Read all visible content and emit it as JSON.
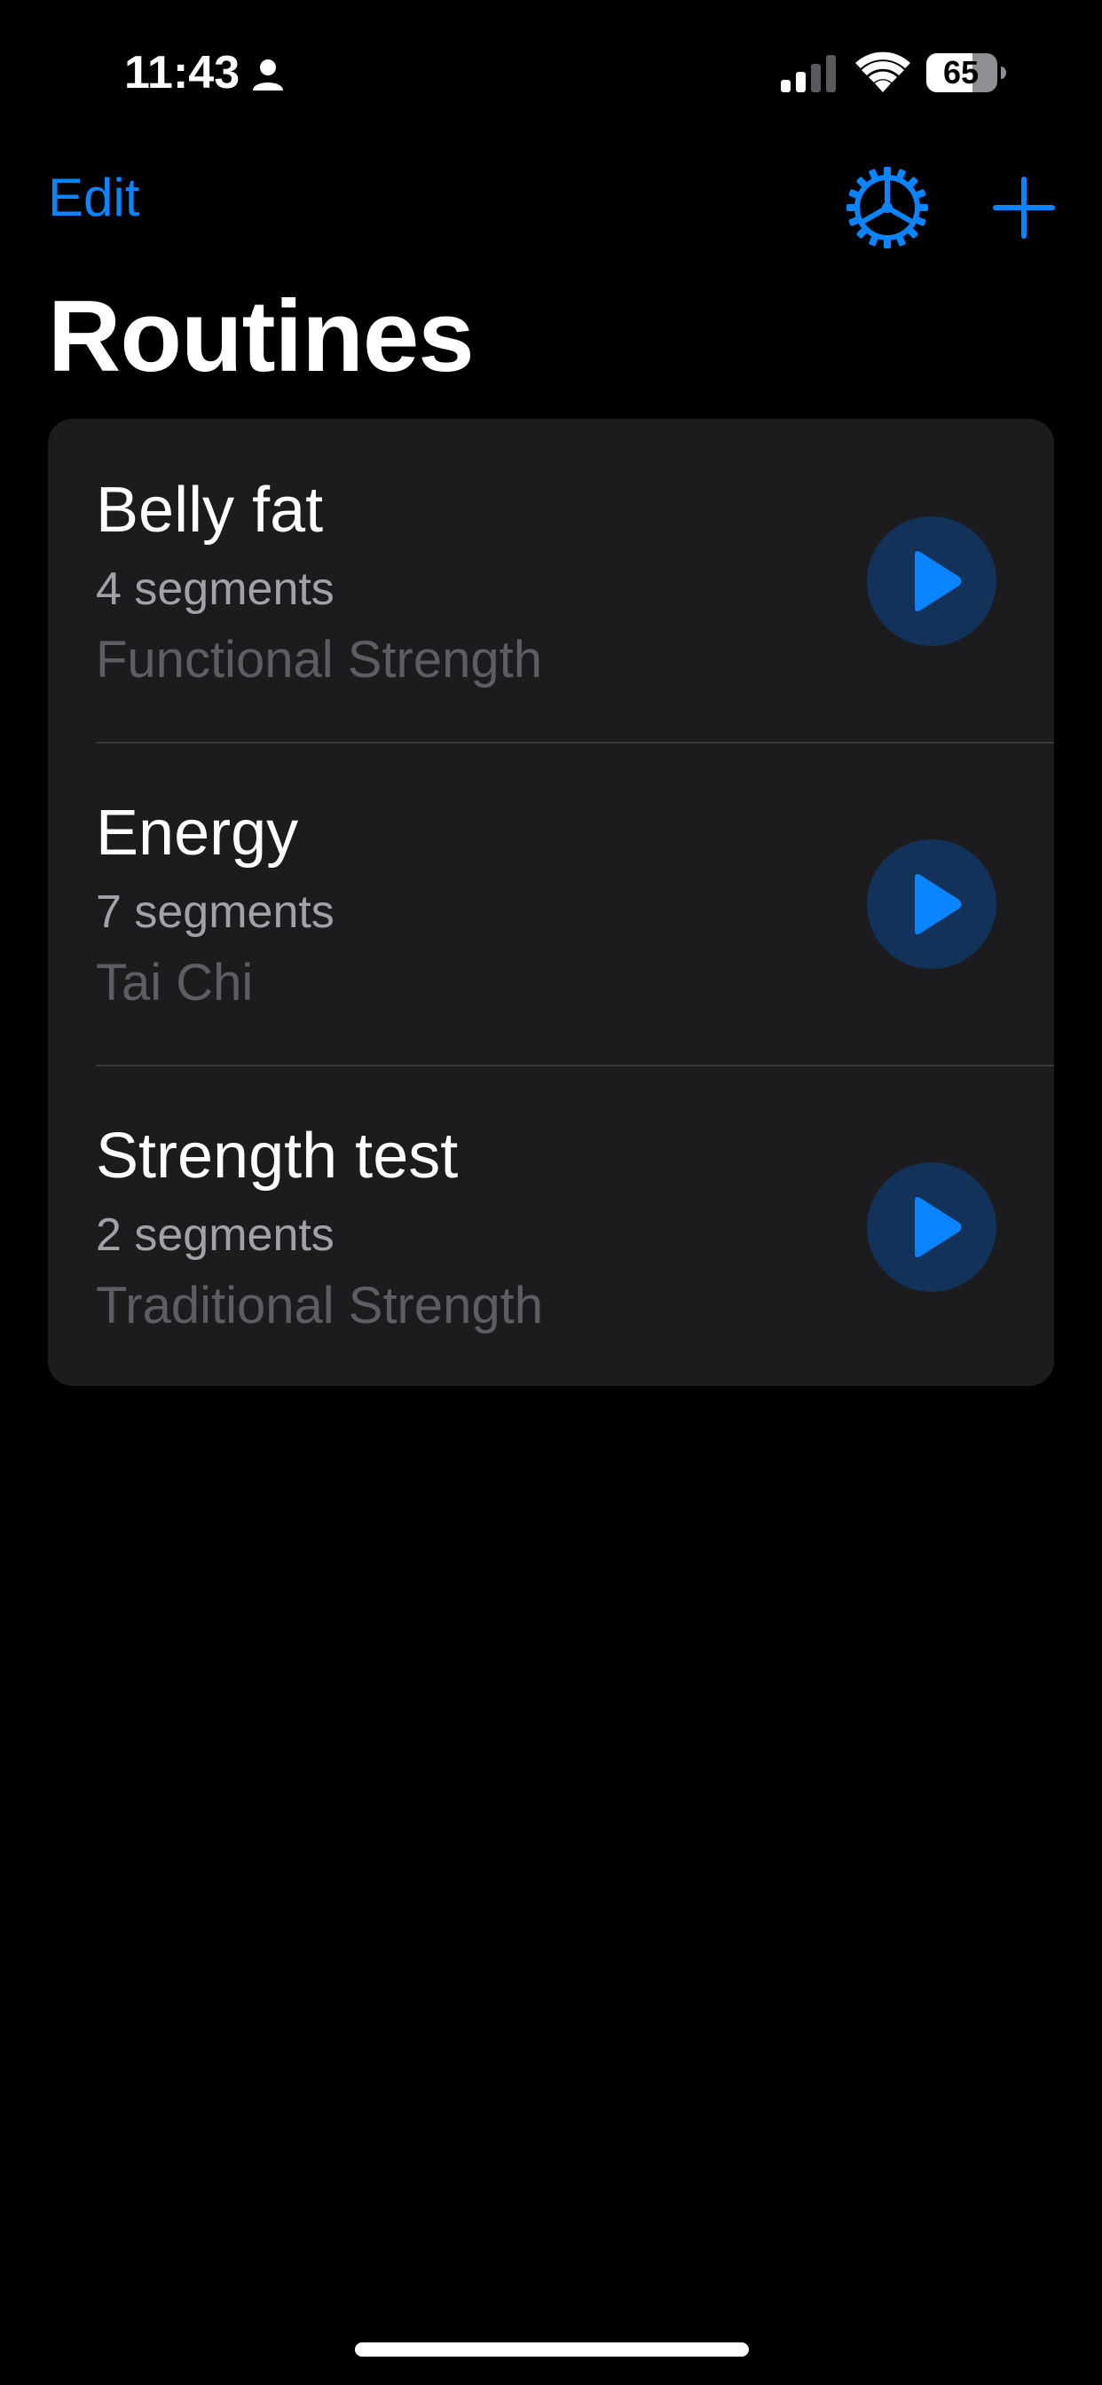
{
  "status_bar": {
    "time": "11:43",
    "battery": "65",
    "icons": [
      "person-icon",
      "signal-icon",
      "wifi-icon",
      "battery-icon"
    ]
  },
  "nav": {
    "edit_label": "Edit",
    "settings_icon": "gear-icon",
    "add_icon": "plus-icon"
  },
  "title": "Routines",
  "routines": [
    {
      "name": "Belly fat",
      "segments": "4 segments",
      "type": "Functional Strength"
    },
    {
      "name": "Energy",
      "segments": "7 segments",
      "type": "Tai Chi"
    },
    {
      "name": "Strength test",
      "segments": "2 segments",
      "type": "Traditional Strength"
    }
  ],
  "colors": {
    "accent": "#0A84FF",
    "background": "#000000",
    "card": "#1C1C1E",
    "play_bg": "#12325A",
    "secondary_text": "#A1A1A6",
    "tertiary_text": "#5D5D62"
  }
}
